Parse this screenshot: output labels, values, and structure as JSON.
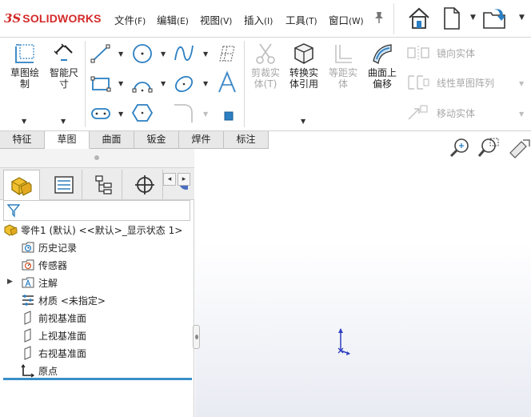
{
  "app": {
    "logo_ds": "3S",
    "logo_brand": "SOLIDWORKS",
    "brand_color": "#d42a2a"
  },
  "menu": [
    {
      "label": "文件",
      "accel": "(F)"
    },
    {
      "label": "编辑",
      "accel": "(E)"
    },
    {
      "label": "视图",
      "accel": "(V)"
    },
    {
      "label": "插入",
      "accel": "(I)"
    },
    {
      "label": "工具",
      "accel": "(T)"
    },
    {
      "label": "窗口",
      "accel": "(W)"
    }
  ],
  "quick_access": {
    "icons": [
      "home-icon",
      "new-document-icon",
      "open-icon"
    ]
  },
  "ribbon": {
    "sketch": "草图绘\n制",
    "smart_dimension": "智能尺\n寸",
    "trim": "剪裁实\n体(T)",
    "convert": "转换实\n体引用",
    "offset": "等距实\n体",
    "surface_offset": "曲面上\n偏移",
    "mirror": "镜向实体",
    "linear_pattern": "线性草图阵列",
    "move": "移动实体"
  },
  "tabs": [
    "特征",
    "草图",
    "曲面",
    "钣金",
    "焊件",
    "标注"
  ],
  "active_tab": "草图",
  "tree": {
    "root": "零件1 (默认) <<默认>_显示状态 1>",
    "items": [
      {
        "label": "历史记录"
      },
      {
        "label": "传感器"
      },
      {
        "label": "注解"
      },
      {
        "label": "材质 <未指定>"
      },
      {
        "label": "前视基准面"
      },
      {
        "label": "上视基准面"
      },
      {
        "label": "右视基准面"
      },
      {
        "label": "原点"
      }
    ]
  },
  "colors": {
    "accent_blue": "#3a8fc7",
    "disabled_text": "#a8a8a8",
    "triad_blue": "#2f3fbf"
  }
}
